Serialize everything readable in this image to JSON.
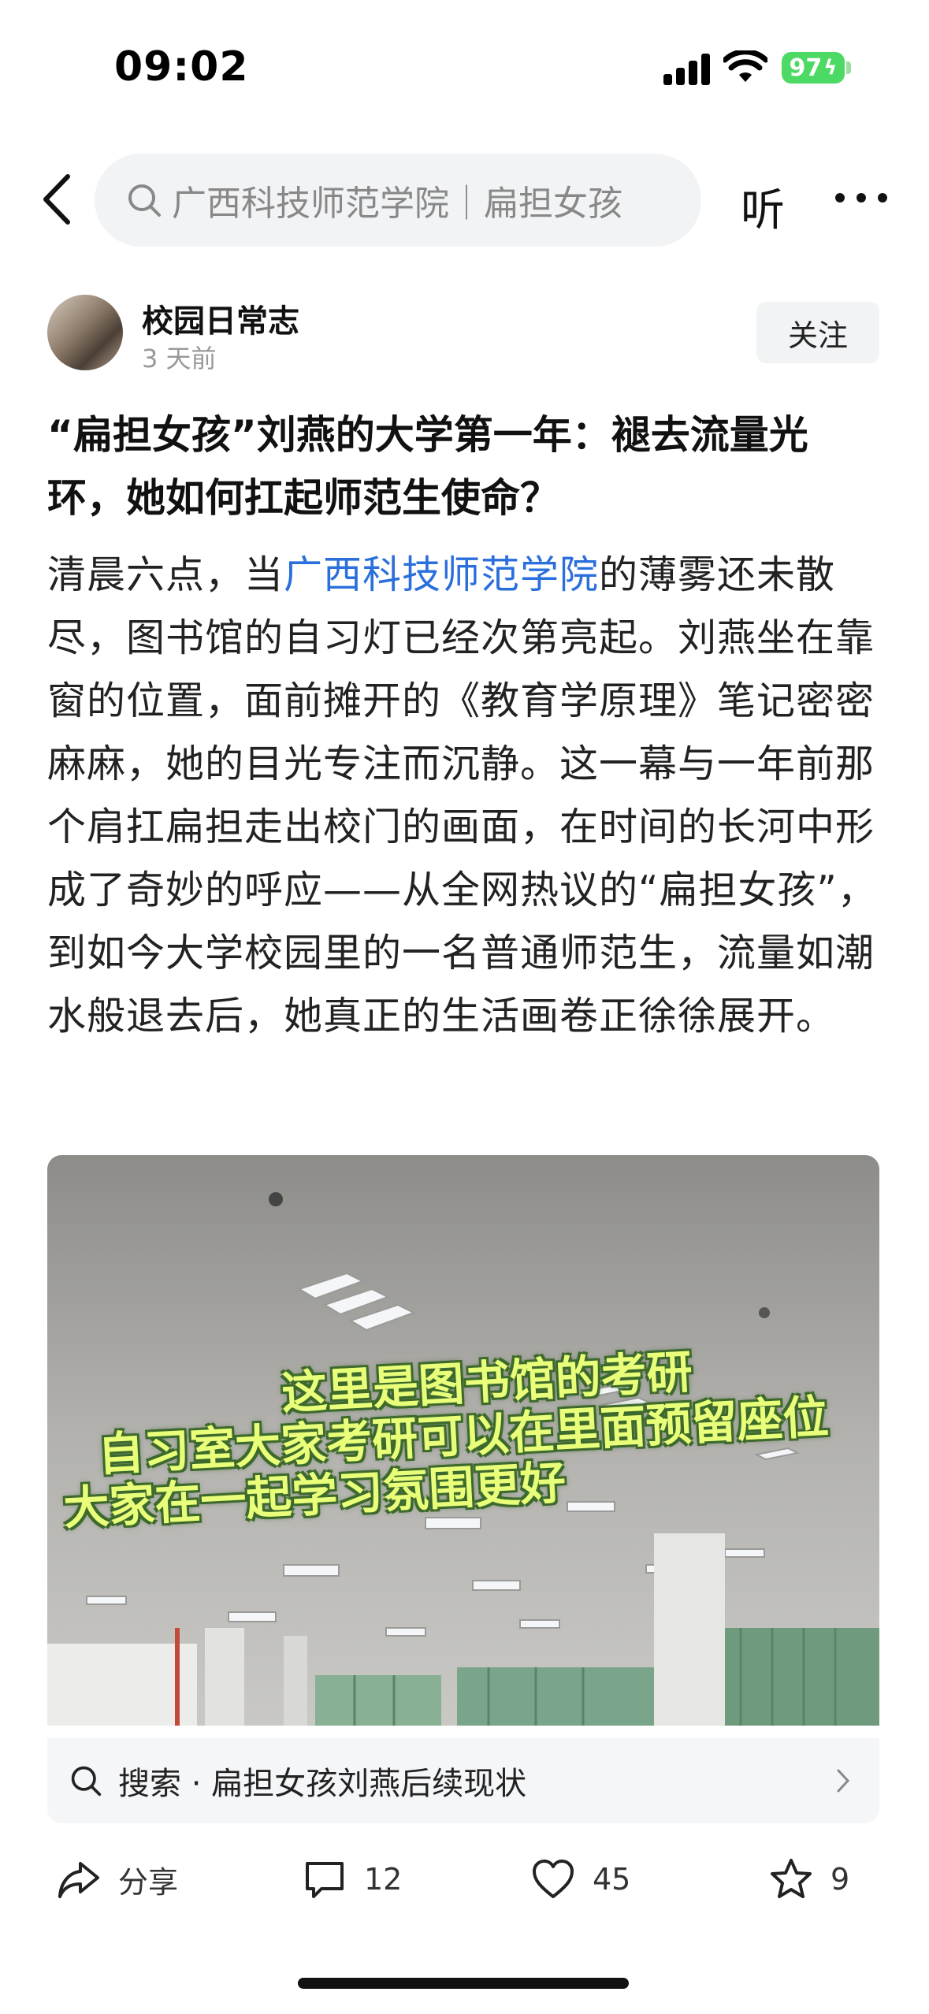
{
  "status_bar": {
    "time": "09:02",
    "battery": "97"
  },
  "nav": {
    "search_value": "广西科技师范学院｜扁担女孩",
    "listen_label": "听"
  },
  "author": {
    "name": "校园日常志",
    "time": "3 天前",
    "follow_label": "关注"
  },
  "article": {
    "title": "“扁担女孩”刘燕的大学第一年：褪去流量光环，她如何扛起师范生使命？",
    "body_before": "清晨六点，当",
    "body_link": "广西科技师范学院",
    "body_after": "的薄雾还未散尽，图书馆的自习灯已经次第亮起。刘燕坐在靠窗的位置，面前摊开的《教育学原理》笔记密密麻麻，她的目光专注而沉静。这一幕与一年前那个肩扛扁担走出校门的画面，在时间的长河中形成了奇妙的呼应——从全网热议的“扁担女孩”，到如今大学校园里的一名普通师范生，流量如潮水般退去后，她真正的生活画卷正徐徐展开。"
  },
  "photo": {
    "caption_line1": "这里是图书馆的考研",
    "caption_line2": "自习室大家考研可以在里面预留座位",
    "caption_line3": "大家在一起学习氛围更好"
  },
  "search_suggestion": {
    "label": "搜索 · 扁担女孩刘燕后续现状"
  },
  "actions": {
    "share_label": "分享",
    "comment_count": "12",
    "like_count": "45",
    "favorite_count": "9"
  },
  "icons": [
    "back-icon",
    "search-icon",
    "more-icon",
    "chevron-right-icon",
    "share-icon",
    "comment-icon",
    "heart-icon",
    "star-icon"
  ],
  "colors": {
    "link": "#2a6fdb",
    "battery": "#4cd964",
    "caption": "#e9ff7a"
  }
}
